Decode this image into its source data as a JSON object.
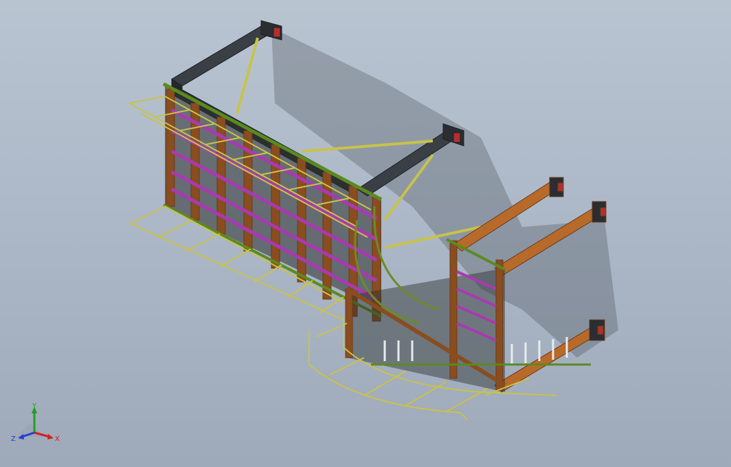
{
  "viewport": {
    "background_top": "#b9c4d1",
    "background_bottom": "#9ea9b9",
    "model_colors": {
      "black_beam": "#2e3236",
      "brown_column": "#8a4d1f",
      "orange_beam": "#b86a2a",
      "green_rail": "#5a8a1f",
      "yellow_cage": "#c9c24a",
      "magenta_rung": "#a83ab0",
      "end_plate": "#b03030"
    }
  },
  "triad": {
    "x_label": "X",
    "y_label": "Y",
    "z_label": "Z",
    "x_color": "#d02020",
    "y_color": "#20a020",
    "z_color": "#2040d0"
  }
}
